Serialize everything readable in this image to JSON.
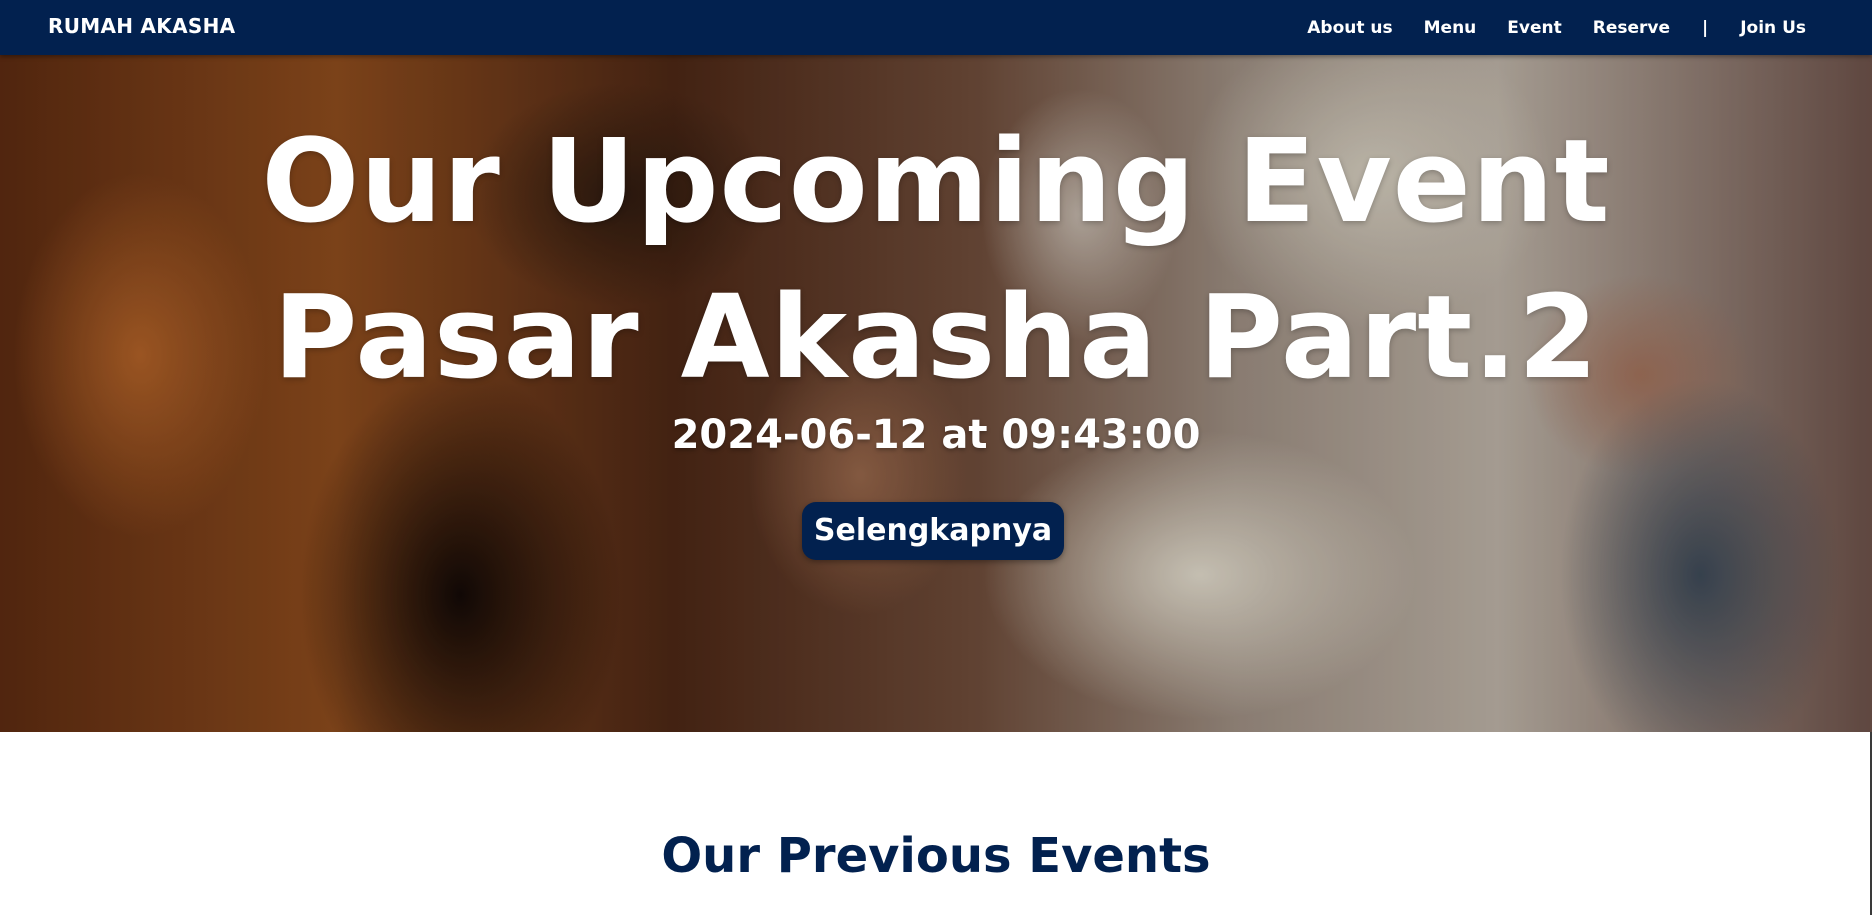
{
  "nav": {
    "brand": "RUMAH AKASHA",
    "links": [
      {
        "label": "About us"
      },
      {
        "label": "Menu"
      },
      {
        "label": "Event"
      },
      {
        "label": "Reserve"
      }
    ],
    "separator": "|",
    "join_label": "Join Us",
    "background_color": "#02214f"
  },
  "hero": {
    "title_line1": "Our Upcoming Event",
    "title_line2": "Pasar Akasha Part.2",
    "datetime": "2024-06-12 at 09:43:00",
    "cta_label": "Selengkapnya",
    "cta_color": "#02214f"
  },
  "previous": {
    "title": "Our Previous Events",
    "title_color": "#02214f"
  }
}
